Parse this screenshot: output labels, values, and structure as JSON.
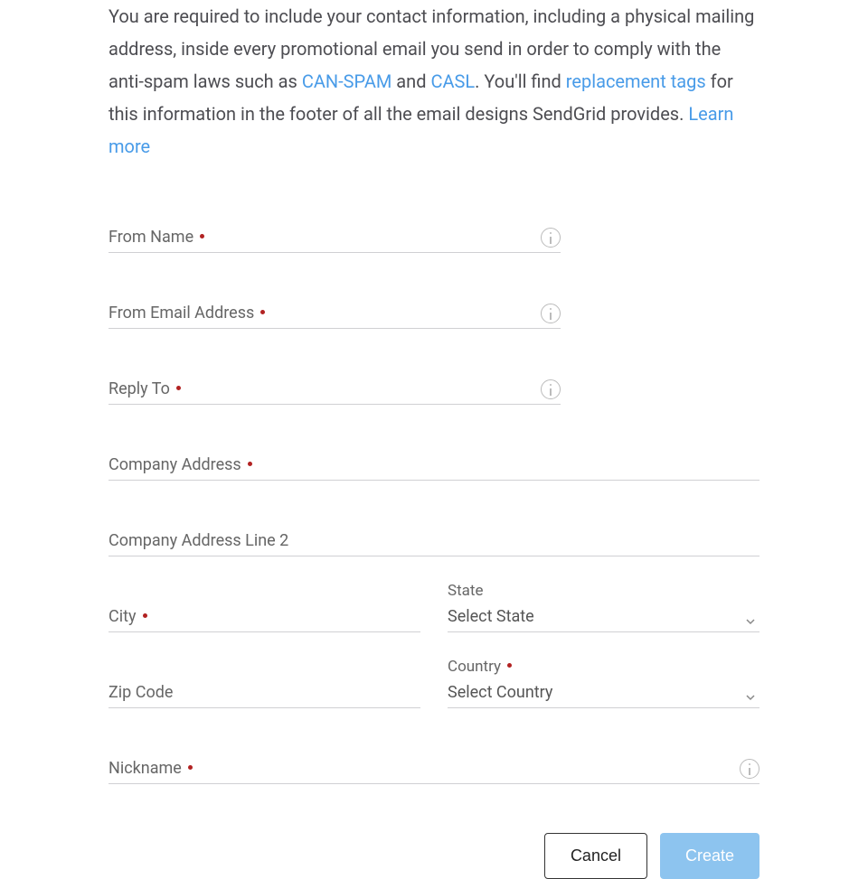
{
  "intro": {
    "part1": "You are required to include your contact information, including a physical mailing address, inside every promotional email you send in order to comply with the anti-spam laws such as ",
    "link_canspam": "CAN-SPAM",
    "part2": " and ",
    "link_casl": "CASL",
    "part3": ". You'll find ",
    "link_replacement": "replacement tags",
    "part4": " for this information in the footer of all the email designs SendGrid provides. ",
    "link_learn": "Learn more"
  },
  "fields": {
    "from_name": {
      "label": "From Name"
    },
    "from_email": {
      "label": "From Email Address"
    },
    "reply_to": {
      "label": "Reply To"
    },
    "company_address": {
      "label": "Company Address"
    },
    "company_address2": {
      "label": "Company Address Line 2"
    },
    "city": {
      "label": "City"
    },
    "state": {
      "label": "State",
      "placeholder": "Select State"
    },
    "zip": {
      "label": "Zip Code"
    },
    "country": {
      "label": "Country",
      "placeholder": "Select Country"
    },
    "nickname": {
      "label": "Nickname"
    }
  },
  "actions": {
    "cancel": "Cancel",
    "create": "Create"
  }
}
